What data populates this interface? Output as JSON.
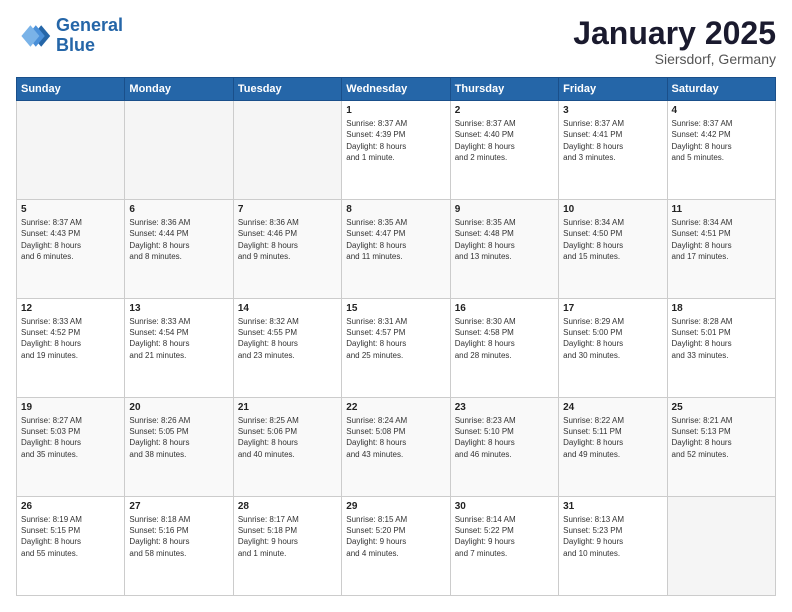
{
  "header": {
    "logo_line1": "General",
    "logo_line2": "Blue",
    "month_title": "January 2025",
    "subtitle": "Siersdorf, Germany"
  },
  "weekdays": [
    "Sunday",
    "Monday",
    "Tuesday",
    "Wednesday",
    "Thursday",
    "Friday",
    "Saturday"
  ],
  "weeks": [
    [
      {
        "day": "",
        "info": ""
      },
      {
        "day": "",
        "info": ""
      },
      {
        "day": "",
        "info": ""
      },
      {
        "day": "1",
        "info": "Sunrise: 8:37 AM\nSunset: 4:39 PM\nDaylight: 8 hours\nand 1 minute."
      },
      {
        "day": "2",
        "info": "Sunrise: 8:37 AM\nSunset: 4:40 PM\nDaylight: 8 hours\nand 2 minutes."
      },
      {
        "day": "3",
        "info": "Sunrise: 8:37 AM\nSunset: 4:41 PM\nDaylight: 8 hours\nand 3 minutes."
      },
      {
        "day": "4",
        "info": "Sunrise: 8:37 AM\nSunset: 4:42 PM\nDaylight: 8 hours\nand 5 minutes."
      }
    ],
    [
      {
        "day": "5",
        "info": "Sunrise: 8:37 AM\nSunset: 4:43 PM\nDaylight: 8 hours\nand 6 minutes."
      },
      {
        "day": "6",
        "info": "Sunrise: 8:36 AM\nSunset: 4:44 PM\nDaylight: 8 hours\nand 8 minutes."
      },
      {
        "day": "7",
        "info": "Sunrise: 8:36 AM\nSunset: 4:46 PM\nDaylight: 8 hours\nand 9 minutes."
      },
      {
        "day": "8",
        "info": "Sunrise: 8:35 AM\nSunset: 4:47 PM\nDaylight: 8 hours\nand 11 minutes."
      },
      {
        "day": "9",
        "info": "Sunrise: 8:35 AM\nSunset: 4:48 PM\nDaylight: 8 hours\nand 13 minutes."
      },
      {
        "day": "10",
        "info": "Sunrise: 8:34 AM\nSunset: 4:50 PM\nDaylight: 8 hours\nand 15 minutes."
      },
      {
        "day": "11",
        "info": "Sunrise: 8:34 AM\nSunset: 4:51 PM\nDaylight: 8 hours\nand 17 minutes."
      }
    ],
    [
      {
        "day": "12",
        "info": "Sunrise: 8:33 AM\nSunset: 4:52 PM\nDaylight: 8 hours\nand 19 minutes."
      },
      {
        "day": "13",
        "info": "Sunrise: 8:33 AM\nSunset: 4:54 PM\nDaylight: 8 hours\nand 21 minutes."
      },
      {
        "day": "14",
        "info": "Sunrise: 8:32 AM\nSunset: 4:55 PM\nDaylight: 8 hours\nand 23 minutes."
      },
      {
        "day": "15",
        "info": "Sunrise: 8:31 AM\nSunset: 4:57 PM\nDaylight: 8 hours\nand 25 minutes."
      },
      {
        "day": "16",
        "info": "Sunrise: 8:30 AM\nSunset: 4:58 PM\nDaylight: 8 hours\nand 28 minutes."
      },
      {
        "day": "17",
        "info": "Sunrise: 8:29 AM\nSunset: 5:00 PM\nDaylight: 8 hours\nand 30 minutes."
      },
      {
        "day": "18",
        "info": "Sunrise: 8:28 AM\nSunset: 5:01 PM\nDaylight: 8 hours\nand 33 minutes."
      }
    ],
    [
      {
        "day": "19",
        "info": "Sunrise: 8:27 AM\nSunset: 5:03 PM\nDaylight: 8 hours\nand 35 minutes."
      },
      {
        "day": "20",
        "info": "Sunrise: 8:26 AM\nSunset: 5:05 PM\nDaylight: 8 hours\nand 38 minutes."
      },
      {
        "day": "21",
        "info": "Sunrise: 8:25 AM\nSunset: 5:06 PM\nDaylight: 8 hours\nand 40 minutes."
      },
      {
        "day": "22",
        "info": "Sunrise: 8:24 AM\nSunset: 5:08 PM\nDaylight: 8 hours\nand 43 minutes."
      },
      {
        "day": "23",
        "info": "Sunrise: 8:23 AM\nSunset: 5:10 PM\nDaylight: 8 hours\nand 46 minutes."
      },
      {
        "day": "24",
        "info": "Sunrise: 8:22 AM\nSunset: 5:11 PM\nDaylight: 8 hours\nand 49 minutes."
      },
      {
        "day": "25",
        "info": "Sunrise: 8:21 AM\nSunset: 5:13 PM\nDaylight: 8 hours\nand 52 minutes."
      }
    ],
    [
      {
        "day": "26",
        "info": "Sunrise: 8:19 AM\nSunset: 5:15 PM\nDaylight: 8 hours\nand 55 minutes."
      },
      {
        "day": "27",
        "info": "Sunrise: 8:18 AM\nSunset: 5:16 PM\nDaylight: 8 hours\nand 58 minutes."
      },
      {
        "day": "28",
        "info": "Sunrise: 8:17 AM\nSunset: 5:18 PM\nDaylight: 9 hours\nand 1 minute."
      },
      {
        "day": "29",
        "info": "Sunrise: 8:15 AM\nSunset: 5:20 PM\nDaylight: 9 hours\nand 4 minutes."
      },
      {
        "day": "30",
        "info": "Sunrise: 8:14 AM\nSunset: 5:22 PM\nDaylight: 9 hours\nand 7 minutes."
      },
      {
        "day": "31",
        "info": "Sunrise: 8:13 AM\nSunset: 5:23 PM\nDaylight: 9 hours\nand 10 minutes."
      },
      {
        "day": "",
        "info": ""
      }
    ]
  ]
}
